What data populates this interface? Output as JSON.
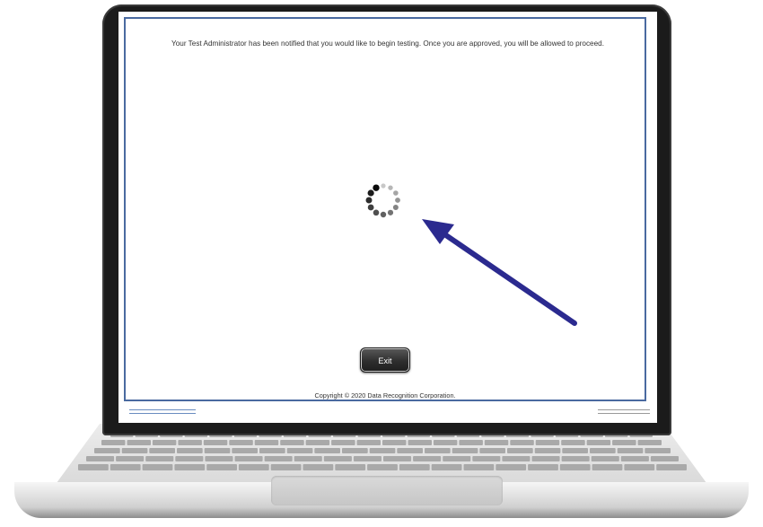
{
  "screen": {
    "message": "Your Test Administrator has been notified that you would like to begin testing. Once you are approved, you will be allowed to proceed.",
    "exit_label": "Exit",
    "copyright": "Copyright © 2020 Data Recognition Corporation."
  },
  "spinner": {
    "icon": "loading-spinner-icon",
    "dot_count": 12
  },
  "annotation": {
    "icon": "arrow-icon",
    "color": "#2b2a8f"
  },
  "colors": {
    "frame_border": "#4a6aa0",
    "button_bg": "#2e2e2e",
    "bezel": "#1b1b1b"
  }
}
